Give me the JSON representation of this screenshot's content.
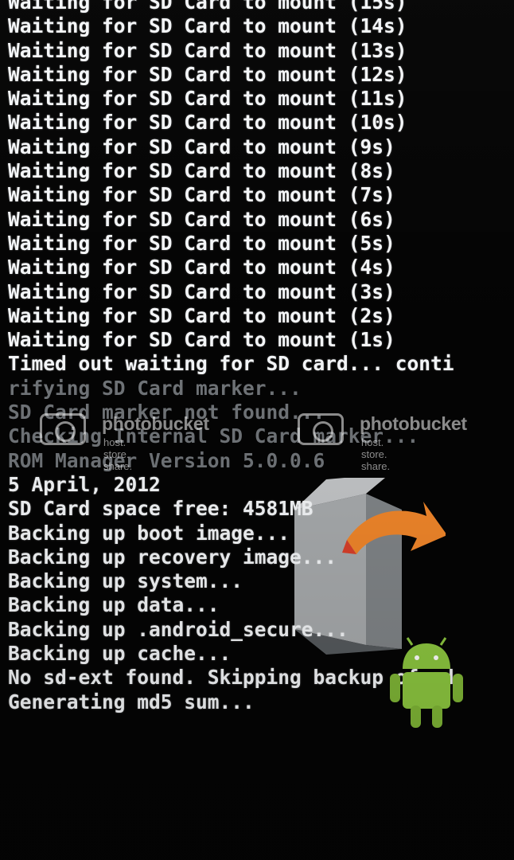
{
  "console": {
    "lines": [
      "Waiting for SD Card to mount (15s)",
      "Waiting for SD Card to mount (14s)",
      "Waiting for SD Card to mount (13s)",
      "Waiting for SD Card to mount (12s)",
      "Waiting for SD Card to mount (11s)",
      "Waiting for SD Card to mount (10s)",
      "Waiting for SD Card to mount (9s)",
      "Waiting for SD Card to mount (8s)",
      "Waiting for SD Card to mount (7s)",
      "Waiting for SD Card to mount (6s)",
      "Waiting for SD Card to mount (5s)",
      "Waiting for SD Card to mount (4s)",
      "Waiting for SD Card to mount (3s)",
      "Waiting for SD Card to mount (2s)",
      "Waiting for SD Card to mount (1s)",
      "Timed out waiting for SD card... conti",
      "rifying SD Card marker...",
      "SD Card marker not found...",
      "Checking Internal SD Card marker...",
      "ROM Manager Version 5.0.0.6",
      "5 April, 2012",
      "SD Card space free: 4581MB",
      "Backing up boot image...",
      "Backing up recovery image...",
      "Backing up system...",
      "Backing up data...",
      "Backing up .android_secure...",
      "Backing up cache...",
      "No sd-ext found. Skipping backup of sd",
      "Generating md5 sum..."
    ],
    "dim_lines": [
      16,
      17,
      18,
      19
    ]
  },
  "watermarks": [
    {
      "brand": "photobucket",
      "tagline": "host. store. share."
    },
    {
      "brand": "photobucket",
      "tagline": "host. store. share."
    }
  ],
  "graphics": {
    "box_icon": "recovery-install-box-icon",
    "arrow_icon": "orange-arrow-icon",
    "android_icon": "android-robot-icon"
  },
  "colors": {
    "text": "#f4f6f8",
    "dim_text": "#6f7377",
    "background": "#040404",
    "arrow": "#f0862a",
    "android": "#8cc63f"
  }
}
